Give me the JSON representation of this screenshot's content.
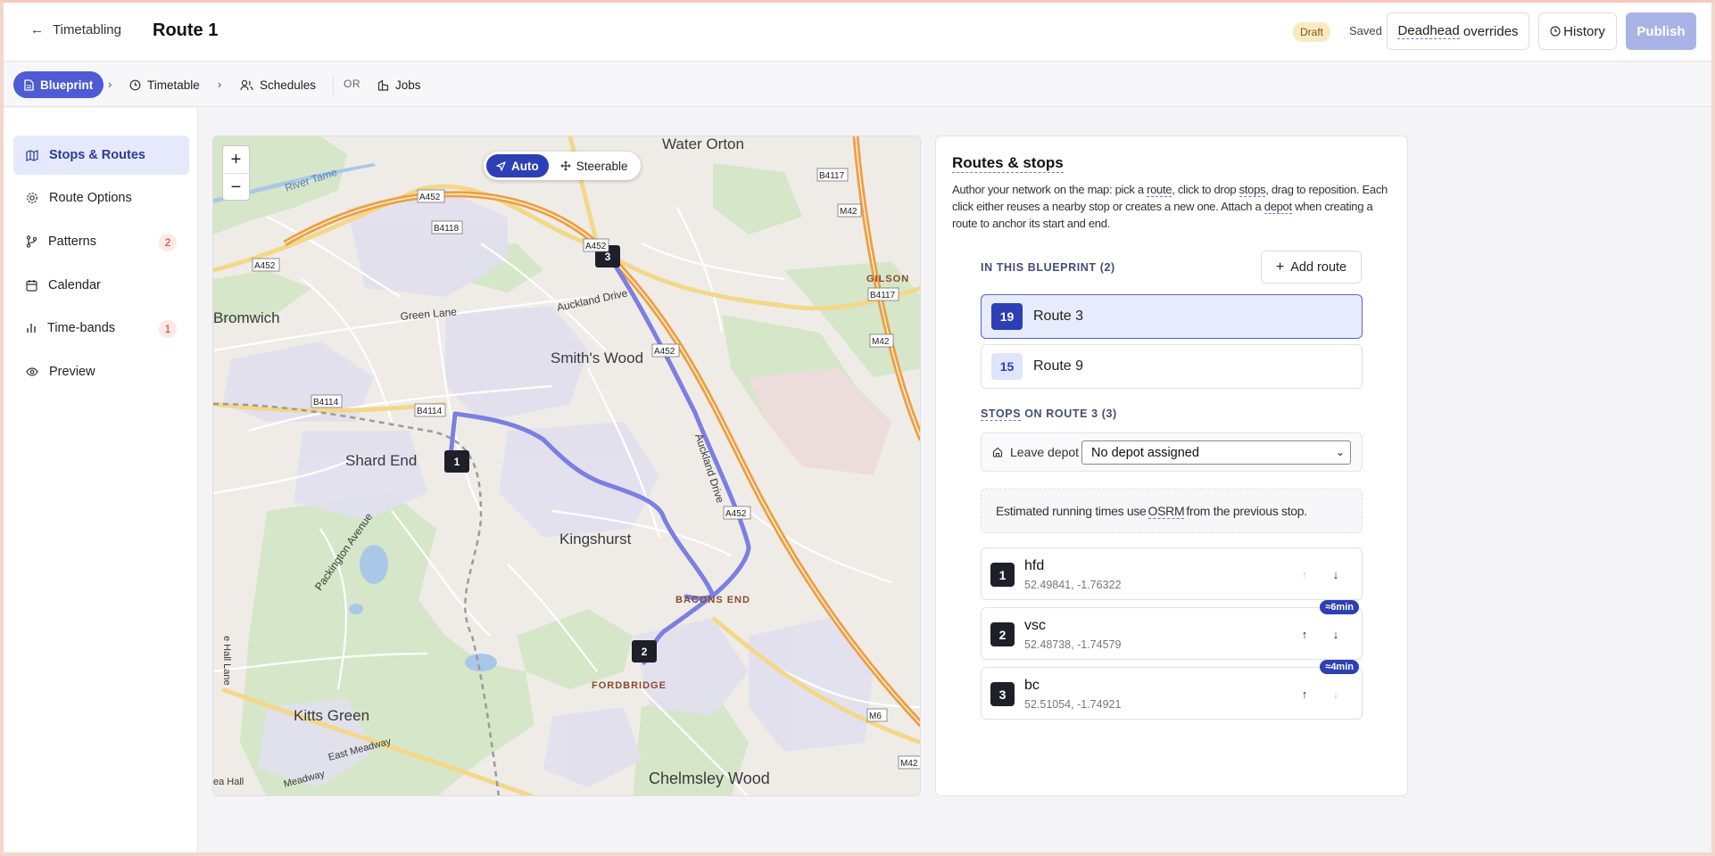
{
  "header": {
    "back_label": "Timetabling",
    "title": "Route 1",
    "status_badge": "Draft",
    "saved_label": "Saved",
    "deadhead_label_1": "Deadhead",
    "deadhead_label_2": " overrides",
    "history_label": "History",
    "publish_label": "Publish"
  },
  "nav": {
    "blueprint": "Blueprint",
    "timetable": "Timetable",
    "schedules": "Schedules",
    "or": "OR",
    "jobs": "Jobs"
  },
  "sidebar": {
    "items": [
      {
        "label": "Stops & Routes",
        "icon": "map-icon"
      },
      {
        "label": "Route Options",
        "icon": "gear-icon"
      },
      {
        "label": "Patterns",
        "icon": "branch-icon",
        "count": "2"
      },
      {
        "label": "Calendar",
        "icon": "calendar-icon"
      },
      {
        "label": "Time-bands",
        "icon": "bar-chart-icon",
        "count": "1"
      },
      {
        "label": "Preview",
        "icon": "eye-icon"
      }
    ]
  },
  "map": {
    "zoom_in": "+",
    "zoom_out": "−",
    "mode_auto": "Auto",
    "mode_steerable": "Steerable",
    "places": {
      "water_orton": "Water Orton",
      "gilson": "GILSON",
      "bromwich": "Bromwich",
      "smiths_wood": "Smith's Wood",
      "shard_end": "Shard End",
      "kingshurst": "Kingshurst",
      "bacons_end": "BACONS END",
      "fordbridge": "FORDBRIDGE",
      "kitts_green": "Kitts Green",
      "chelmsley_wood": "Chelmsley Wood",
      "lea_hall": "ea Hall",
      "river_tame": "River Tame",
      "green_lane": "Green Lane",
      "auckland_drive": "Auckland Drive",
      "auckland_drive_2": "Auckland Drive",
      "packington_avenue": "Packington Avenue",
      "east_meadway": "East Meadway",
      "meadway": "Meadway",
      "hall_lane": "e Hall Lane"
    },
    "road_labels": {
      "a452_1": "A452",
      "a452_2": "A452",
      "a452_3": "A452",
      "a452_4": "A452",
      "a452_5": "A452",
      "b4118": "B4118",
      "b4117_1": "B4117",
      "b4117_2": "B4117",
      "m42_1": "M42",
      "m42_2": "M42",
      "m42_3": "M42",
      "b4114_1": "B4114",
      "b4114_2": "B4114",
      "m6": "M6"
    },
    "markers": [
      "1",
      "2",
      "3"
    ],
    "route_color": "#7b7fe0"
  },
  "panel": {
    "title": "Routes & stops",
    "desc_1": "Author your network on the map: pick a ",
    "desc_route": "route",
    "desc_2": ", click to drop ",
    "desc_stops": "stops",
    "desc_3": ", drag to reposition. Each click either reuses a nearby stop or creates a new one. Attach a ",
    "desc_depot": "depot",
    "desc_4": " when creating a route to anchor its start and end.",
    "in_blueprint_label": "IN THIS BLUEPRINT (2)",
    "add_route_label": "Add route",
    "routes": [
      {
        "number": "19",
        "name": "Route 3"
      },
      {
        "number": "15",
        "name": "Route 9"
      }
    ],
    "stops_label_1": "STOPS",
    "stops_label_2": " ON ROUTE 3 (3)",
    "leave_depot_label": "Leave depot",
    "depot_select_value": "No depot assigned",
    "info_1": "Estimated running times use ",
    "info_osrm": "OSRM",
    "info_2": " from the previous stop.",
    "stops": [
      {
        "seq": "1",
        "name": "hfd",
        "coords": "52.49841, -1.76322",
        "eta": ""
      },
      {
        "seq": "2",
        "name": "vsc",
        "coords": "52.48738, -1.74579",
        "eta": "≈6min"
      },
      {
        "seq": "3",
        "name": "bc",
        "coords": "52.51054, -1.74921",
        "eta": "≈4min"
      }
    ]
  },
  "colors": {
    "accent": "#2d3fb5",
    "accent_light": "#e6e9fb",
    "publish_disabled": "#a9b3e6",
    "route_line": "#7b7fe0"
  }
}
